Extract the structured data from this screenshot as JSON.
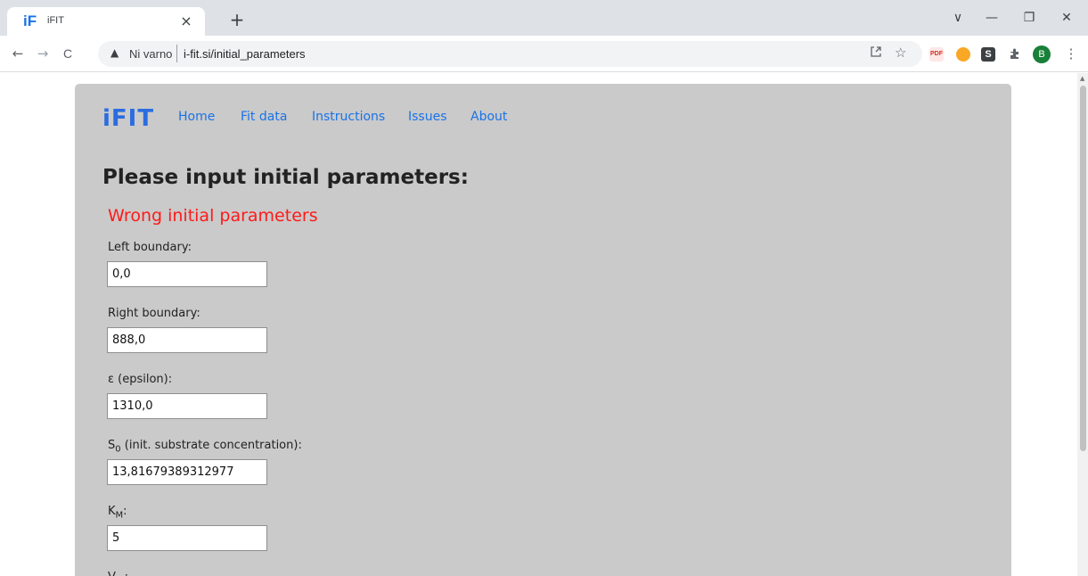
{
  "browser": {
    "tab": {
      "favicon_text": "iF",
      "title": "iFIT",
      "close": "×"
    },
    "new_tab": "+",
    "window_controls": {
      "tab_search": "∨",
      "minimize": "—",
      "restore": "❐",
      "close": "✕"
    },
    "nav": {
      "back": "←",
      "forward": "→",
      "reload": "C"
    },
    "omnibox": {
      "warning": "▲",
      "security_text": "Ni varno",
      "url": "i-fit.si/initial_parameters"
    },
    "extensions": {
      "profile_initial": "B",
      "s_ext": "S",
      "menu": "⋮"
    }
  },
  "site": {
    "brand": "iFIT",
    "nav": [
      "Home",
      "Fit data",
      "Instructions",
      "Issues",
      "About"
    ]
  },
  "form": {
    "heading": "Please input initial parameters:",
    "error": "Wrong initial parameters",
    "fields": [
      {
        "label": "Left boundary:",
        "value": "0,0"
      },
      {
        "label": "Right boundary:",
        "value": "888,0"
      },
      {
        "label": "ε (epsilon):",
        "value": "1310,0"
      },
      {
        "label_main": "S",
        "label_sub": "0",
        "label_rest": " (init. substrate concentration):",
        "value": "13,81679389312977"
      },
      {
        "label_main": "K",
        "label_sub": "M",
        "label_rest": ":",
        "value": "5"
      },
      {
        "label_main": "V",
        "label_sub": "m",
        "label_rest": ":"
      }
    ]
  },
  "colors": {
    "brand": "#2b6de0",
    "link": "#1a73e8",
    "error": "#ff1a1a",
    "card": "#cacaca"
  }
}
